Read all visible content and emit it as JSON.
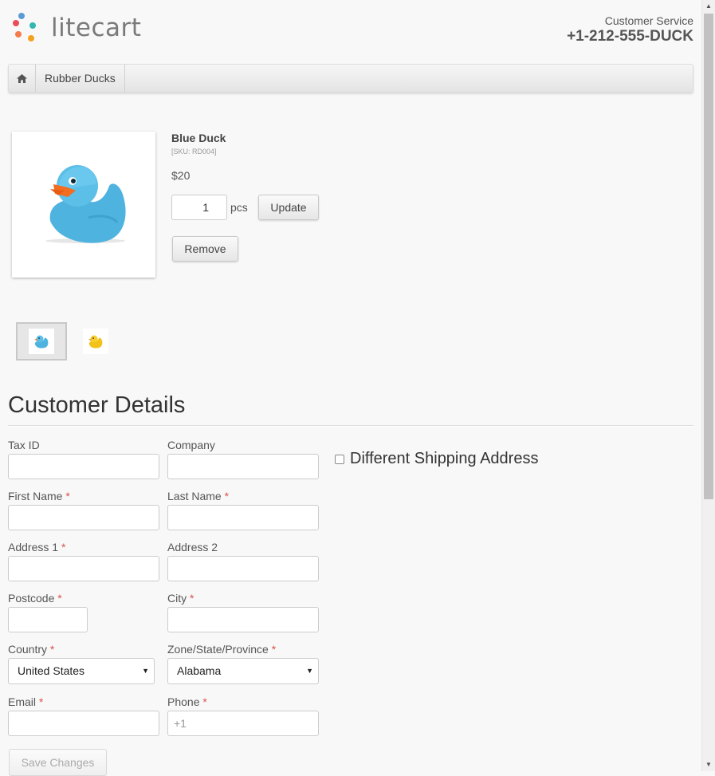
{
  "header": {
    "logo_text": "litecart",
    "customer_service_label": "Customer Service",
    "phone": "+1-212-555-DUCK"
  },
  "breadcrumb": {
    "home_icon": "home-icon",
    "items": [
      "Rubber Ducks"
    ]
  },
  "cart_item": {
    "name": "Blue Duck",
    "sku": "[SKU: RD004]",
    "price": "$20",
    "quantity": "1",
    "unit": "pcs",
    "update_label": "Update",
    "remove_label": "Remove"
  },
  "thumbnails": [
    {
      "name": "Blue Duck",
      "color": "#4fb7e2",
      "selected": true
    },
    {
      "name": "Yellow Duck",
      "color": "#f2c21b",
      "selected": false
    }
  ],
  "customer_details": {
    "title": "Customer Details",
    "fields": {
      "tax_id": {
        "label": "Tax ID",
        "value": ""
      },
      "company": {
        "label": "Company",
        "value": ""
      },
      "first_name": {
        "label": "First Name",
        "required": "*",
        "value": ""
      },
      "last_name": {
        "label": "Last Name",
        "required": "*",
        "value": ""
      },
      "address1": {
        "label": "Address 1",
        "required": "*",
        "value": ""
      },
      "address2": {
        "label": "Address 2",
        "value": ""
      },
      "postcode": {
        "label": "Postcode",
        "required": "*",
        "value": ""
      },
      "city": {
        "label": "City",
        "required": "*",
        "value": ""
      },
      "country": {
        "label": "Country",
        "required": "*",
        "value": "United States"
      },
      "zone": {
        "label": "Zone/State/Province",
        "required": "*",
        "value": "Alabama"
      },
      "email": {
        "label": "Email",
        "required": "*",
        "value": ""
      },
      "phone": {
        "label": "Phone",
        "required": "*",
        "placeholder": "+1",
        "value": ""
      }
    },
    "different_shipping_label": "Different Shipping Address",
    "different_shipping_checked": false,
    "save_label": "Save Changes"
  },
  "colors": {
    "required": "#d9534f",
    "logo_dots": [
      "#e94e5a",
      "#4aa0e0",
      "#f4a21c",
      "#34b6b0",
      "#e95f7a"
    ]
  }
}
